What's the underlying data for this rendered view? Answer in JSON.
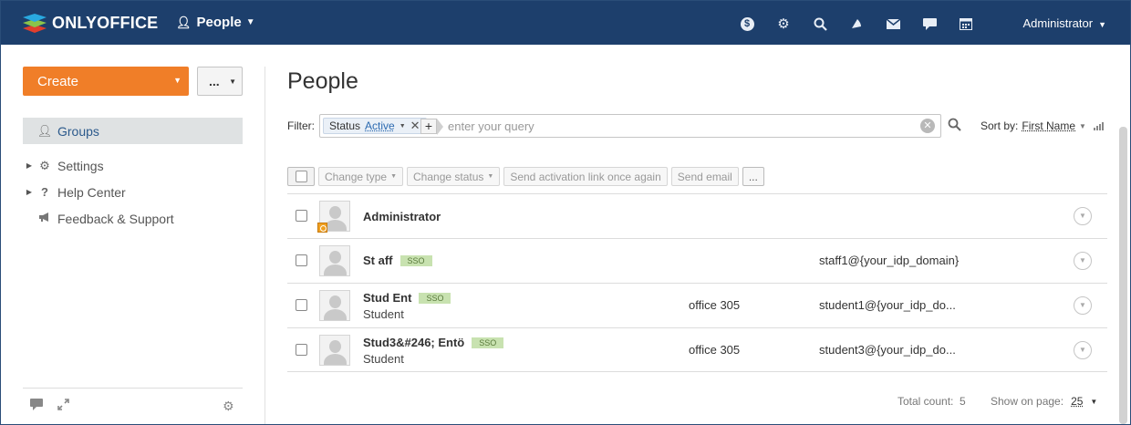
{
  "header": {
    "logo_text": "ONLYOFFICE",
    "module_label": "People",
    "icons": [
      "payments-icon",
      "settings-icon",
      "search-icon",
      "feed-icon",
      "mail-icon",
      "talk-icon",
      "calendar-icon"
    ],
    "user_label": "Administrator",
    "bg_color": "#1d3f6c"
  },
  "sidebar": {
    "create_label": "Create",
    "more_label": "...",
    "items": [
      {
        "label": "Groups",
        "icon": "user-icon",
        "active": true
      },
      {
        "label": "Settings",
        "icon": "gear-icon",
        "expandable": true
      },
      {
        "label": "Help Center",
        "icon": "help-icon",
        "expandable": true
      },
      {
        "label": "Feedback & Support",
        "icon": "megaphone-icon"
      }
    ],
    "accent_color": "#f07e28"
  },
  "main": {
    "title": "People",
    "filter": {
      "label": "Filter:",
      "chip_key": "Status",
      "chip_value": "Active",
      "placeholder": "enter your query"
    },
    "sort": {
      "label": "Sort by:",
      "value": "First Name"
    },
    "actions": {
      "change_type": "Change type",
      "change_status": "Change status",
      "send_activation": "Send activation link once again",
      "send_email": "Send email",
      "more": "..."
    },
    "users": [
      {
        "name": "Administrator",
        "sso": "",
        "title": "",
        "office": "",
        "email": "",
        "admin": true
      },
      {
        "name": "St aff",
        "sso": "SSO",
        "title": "",
        "office": "",
        "email": "staff1@{your_idp_domain}"
      },
      {
        "name": "Stud Ent",
        "sso": "SSO",
        "title": "Student",
        "office": "office 305",
        "email": "student1@{your_idp_do..."
      },
      {
        "name": "Stud3&#246; Entö",
        "sso": "SSO",
        "title": "Student",
        "office": "office 305",
        "email": "student3@{your_idp_do..."
      }
    ]
  },
  "footer": {
    "total_label": "Total count:",
    "total_value": "5",
    "show_label": "Show on page:",
    "show_value": "25"
  }
}
